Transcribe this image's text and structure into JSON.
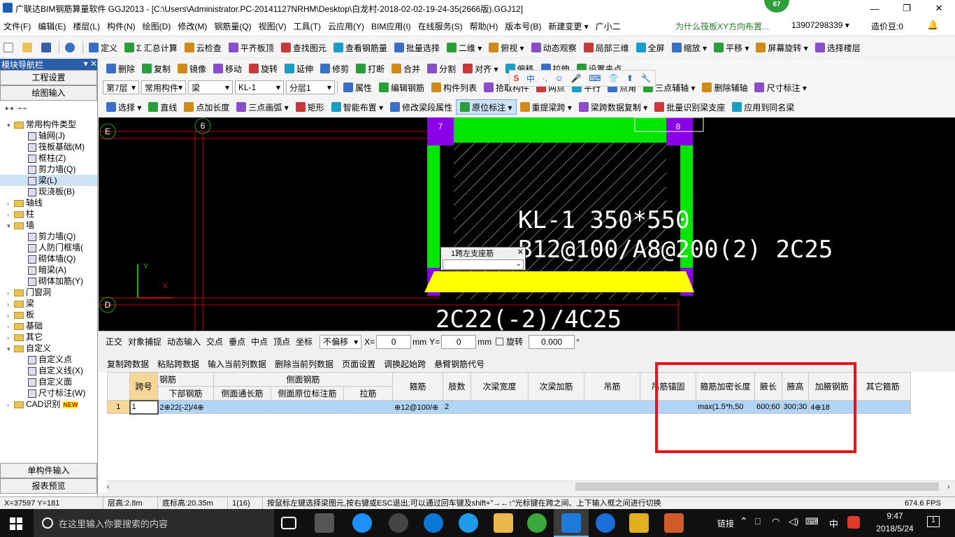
{
  "window": {
    "title": "广联达BIM钢筋算量软件 GGJ2013 - [C:\\Users\\Administrator.PC-20141127NRHM\\Desktop\\白龙村-2018-02-02-19-24-35(2666版).GGJ12]",
    "badge": "67",
    "controls": [
      "—",
      "❐",
      "✕"
    ]
  },
  "menu": {
    "items": [
      "文件(F)",
      "编辑(E)",
      "楼层(L)",
      "构件(N)",
      "绘图(D)",
      "修改(M)",
      "钢筋量(Q)",
      "视图(V)",
      "工具(T)",
      "云应用(Y)",
      "BIM应用(I)",
      "在线服务(S)",
      "帮助(H)",
      "版本号(B)",
      "新建变更 ▾",
      "广小二"
    ],
    "question": "为什么筏板XY方向布置...",
    "phone": "13907298339 ▾",
    "coins": "造价豆:0",
    "bell": "🔔"
  },
  "toolbar1": {
    "items": [
      "定义",
      "Σ 汇总计算",
      "云检查",
      "平齐板顶",
      "查找图元",
      "查看钢筋量",
      "批量选择",
      "二维 ▾",
      "俯视 ▾",
      "动态观察",
      "局部三维",
      "全屏",
      "缩放 ▾",
      "平移 ▾",
      "屏幕旋转 ▾",
      "选择楼层"
    ]
  },
  "toolbar2": {
    "items": [
      "删除",
      "复制",
      "镜像",
      "移动",
      "旋转",
      "延伸",
      "修剪",
      "打断",
      "合并",
      "分割",
      "对齐 ▾",
      "偏移",
      "拉伸",
      "设置夹点"
    ]
  },
  "toolbar3": {
    "floor": "第7层",
    "category": "常用构件",
    "type": "梁",
    "element": "KL-1",
    "layer": "分层1",
    "items": [
      "属性",
      "编辑钢筋",
      "构件列表",
      "拾取构件",
      "两点",
      "平行",
      "点角",
      "三点辅轴 ▾",
      "删除辅轴",
      "尺寸标注 ▾"
    ]
  },
  "toolbar4": {
    "items": [
      "选择 ▾",
      "直线",
      "点加长度",
      "三点画弧 ▾",
      "矩形",
      "智能布置 ▾",
      "修改梁段属性",
      "原位标注 ▾",
      "重提梁跨 ▾",
      "梁跨数据复制 ▾",
      "批量识别梁支座",
      "应用到同名梁"
    ]
  },
  "ime": {
    "items": [
      "S",
      "中",
      "·,",
      "☺",
      "🎤",
      "⌨",
      "👕",
      "⬆",
      "🔧"
    ]
  },
  "leftpanel": {
    "title": "模块导航栏",
    "pin": "▾ ✕",
    "buttons": [
      "工程设置",
      "绘图输入"
    ],
    "bottom_buttons": [
      "单构件输入",
      "报表预览"
    ],
    "tree": [
      {
        "label": "常用构件类型",
        "level": 0,
        "type": "folder",
        "open": true
      },
      {
        "label": "轴网(J)",
        "level": 1,
        "type": "item"
      },
      {
        "label": "筏板基础(M)",
        "level": 1,
        "type": "item"
      },
      {
        "label": "框柱(Z)",
        "level": 1,
        "type": "item"
      },
      {
        "label": "剪力墙(Q)",
        "level": 1,
        "type": "item"
      },
      {
        "label": "梁(L)",
        "level": 1,
        "type": "item",
        "selected": true
      },
      {
        "label": "现浇板(B)",
        "level": 1,
        "type": "item"
      },
      {
        "label": "轴线",
        "level": 0,
        "type": "folder"
      },
      {
        "label": "柱",
        "level": 0,
        "type": "folder"
      },
      {
        "label": "墙",
        "level": 0,
        "type": "folder",
        "open": true
      },
      {
        "label": "剪力墙(Q)",
        "level": 1,
        "type": "item"
      },
      {
        "label": "人防门框墙(",
        "level": 1,
        "type": "item"
      },
      {
        "label": "砌体墙(Q)",
        "level": 1,
        "type": "item"
      },
      {
        "label": "暗梁(A)",
        "level": 1,
        "type": "item"
      },
      {
        "label": "砌体加筋(Y)",
        "level": 1,
        "type": "item"
      },
      {
        "label": "门窗洞",
        "level": 0,
        "type": "folder"
      },
      {
        "label": "梁",
        "level": 0,
        "type": "folder"
      },
      {
        "label": "板",
        "level": 0,
        "type": "folder"
      },
      {
        "label": "基础",
        "level": 0,
        "type": "folder"
      },
      {
        "label": "其它",
        "level": 0,
        "type": "folder"
      },
      {
        "label": "自定义",
        "level": 0,
        "type": "folder",
        "open": true
      },
      {
        "label": "自定义点",
        "level": 1,
        "type": "item"
      },
      {
        "label": "自定义线(X)",
        "level": 1,
        "type": "item"
      },
      {
        "label": "自定义面",
        "level": 1,
        "type": "item"
      },
      {
        "label": "尺寸标注(W)",
        "level": 1,
        "type": "item"
      },
      {
        "label": "CAD识别",
        "level": 0,
        "type": "folder",
        "tag": "NEW"
      }
    ]
  },
  "canvas": {
    "axis_labels": [
      "E",
      "6",
      "7",
      "8",
      "D"
    ],
    "beam_text": "KL-1 350*550",
    "stirrup_text": "B12@100/A8@200(2) 2C25",
    "bottom_text": "2C22(-2)/4C25",
    "popup_title": "1跨左支座筋",
    "popup_close": "✕",
    "ucs_y": "Y",
    "ucs_x": "X"
  },
  "snapbar": {
    "items": [
      "正交",
      "对象捕捉",
      "动态输入",
      "交点",
      "垂点",
      "中点",
      "顶点",
      "坐标"
    ],
    "offset": "不偏移",
    "x_label": "X=",
    "x_value": "0",
    "y_label": "Y=",
    "y_value": "0",
    "unit": "mm",
    "rotate_label": "旋转",
    "rotate_value": "0.000",
    "deg": "°"
  },
  "gridtools": {
    "items": [
      "复制跨数据",
      "粘贴跨数据",
      "输入当前列数据",
      "删除当前列数据",
      "页面设置",
      "调换起始跨",
      "悬臂钢筋代号"
    ]
  },
  "grid": {
    "headers_top": [
      "跨号",
      "钢筋",
      "侧面钢筋",
      "箍筋",
      "肢数",
      "次梁宽度",
      "次梁加筋",
      "吊筋",
      "吊筋锚固",
      "箍筋加密长度",
      "腋长",
      "腋高",
      "加腋钢筋",
      "其它箍筋"
    ],
    "headers_sub": [
      "下部钢筋",
      "侧面通长筋",
      "侧面原位标注筋",
      "拉筋"
    ],
    "rows": [
      {
        "idx": "1",
        "span": "1",
        "bottom": "2⊕22(-2)/4⊕",
        "side_long": "",
        "side_orig": "",
        "tie": "",
        "stirrup": "⊕12@100/⊕",
        "legs": "2",
        "sec_width": "",
        "sec_rebar": "",
        "hanger": "",
        "hanger_anchor": "",
        "dense_len": "max(1.5*h,50",
        "hl": "600;60",
        "hh": "300;30",
        "haunch": "4⊕18",
        "other": ""
      }
    ]
  },
  "status": {
    "coords": "X=37597 Y=181",
    "floor_h": "层高:2.8m",
    "base_h": "底标高:20.35m",
    "span": "1(16)",
    "hint": "按鼠标左键选择梁图元,按右键或ESC退出;可以通过回车键及shift+\"→←↑\"光标键在跨之间、上下输入框之间进行切换",
    "fps": "674.6 FPS"
  },
  "taskbar": {
    "search": "在这里输入你要搜索的内容",
    "tray_link": "链接",
    "lang": "中",
    "time": "9:47",
    "date": "2018/5/24",
    "notif": "1"
  },
  "colors": {
    "green": "#00e600",
    "purple": "#8a00e6",
    "yellow": "#ffff00",
    "magenta": "#d020d0",
    "red_frame": "#e8141b"
  }
}
